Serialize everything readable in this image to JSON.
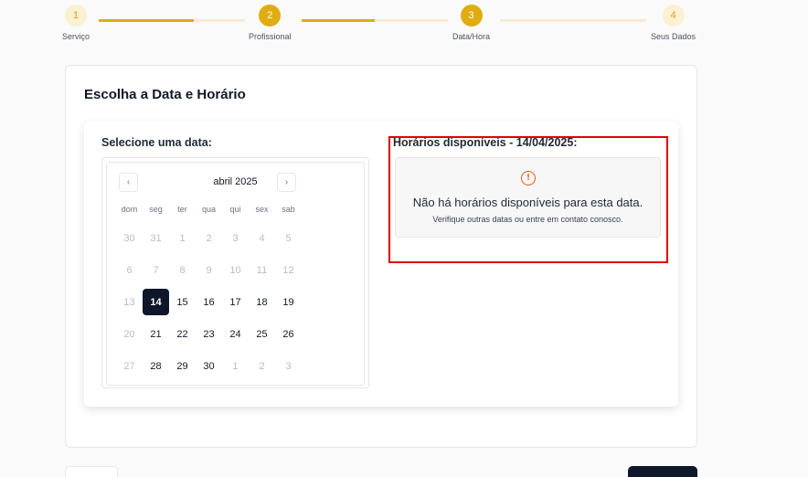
{
  "stepper": {
    "steps": [
      {
        "number": "1",
        "label": "Serviço"
      },
      {
        "number": "2",
        "label": "Profissional"
      },
      {
        "number": "3",
        "label": "Data/Hora"
      },
      {
        "number": "4",
        "label": "Seus Dados"
      }
    ],
    "progress": [
      0.65,
      0.5,
      0
    ]
  },
  "card": {
    "title": "Escolha a Data e Horário"
  },
  "calendar": {
    "label": "Selecione uma data:",
    "month": "abril 2025",
    "prev_icon": "chevron-left-icon",
    "next_icon": "chevron-right-icon",
    "weekdays": [
      "dom",
      "seg",
      "ter",
      "qua",
      "qui",
      "sex",
      "sab"
    ],
    "weeks": [
      [
        {
          "d": "30",
          "s": "muted"
        },
        {
          "d": "31",
          "s": "muted"
        },
        {
          "d": "1",
          "s": "muted"
        },
        {
          "d": "2",
          "s": "muted"
        },
        {
          "d": "3",
          "s": "muted"
        },
        {
          "d": "4",
          "s": "muted"
        },
        {
          "d": "5",
          "s": "muted"
        }
      ],
      [
        {
          "d": "6",
          "s": "muted"
        },
        {
          "d": "7",
          "s": "muted"
        },
        {
          "d": "8",
          "s": "muted"
        },
        {
          "d": "9",
          "s": "muted"
        },
        {
          "d": "10",
          "s": "muted"
        },
        {
          "d": "11",
          "s": "muted"
        },
        {
          "d": "12",
          "s": "muted"
        }
      ],
      [
        {
          "d": "13",
          "s": "muted"
        },
        {
          "d": "14",
          "s": "selected"
        },
        {
          "d": "15",
          "s": "active"
        },
        {
          "d": "16",
          "s": "active"
        },
        {
          "d": "17",
          "s": "active"
        },
        {
          "d": "18",
          "s": "active"
        },
        {
          "d": "19",
          "s": "active"
        }
      ],
      [
        {
          "d": "20",
          "s": "muted"
        },
        {
          "d": "21",
          "s": "active"
        },
        {
          "d": "22",
          "s": "active"
        },
        {
          "d": "23",
          "s": "active"
        },
        {
          "d": "24",
          "s": "active"
        },
        {
          "d": "25",
          "s": "active"
        },
        {
          "d": "26",
          "s": "active"
        }
      ],
      [
        {
          "d": "27",
          "s": "muted"
        },
        {
          "d": "28",
          "s": "active"
        },
        {
          "d": "29",
          "s": "active"
        },
        {
          "d": "30",
          "s": "active"
        },
        {
          "d": "1",
          "s": "muted"
        },
        {
          "d": "2",
          "s": "muted"
        },
        {
          "d": "3",
          "s": "muted"
        }
      ]
    ]
  },
  "times": {
    "label": "Horários disponíveis - 14/04/2025:",
    "empty_icon": "alert-circle-icon",
    "empty_title": "Não há horários disponíveis para esta data.",
    "empty_subtitle": "Verifique outras datas ou entre em contato conosco."
  },
  "colors": {
    "accent": "#e0ac10",
    "accent_light": "#fbf1d1",
    "dark": "#0f172a",
    "highlight": "#e00000",
    "warning": "#ea580c"
  }
}
